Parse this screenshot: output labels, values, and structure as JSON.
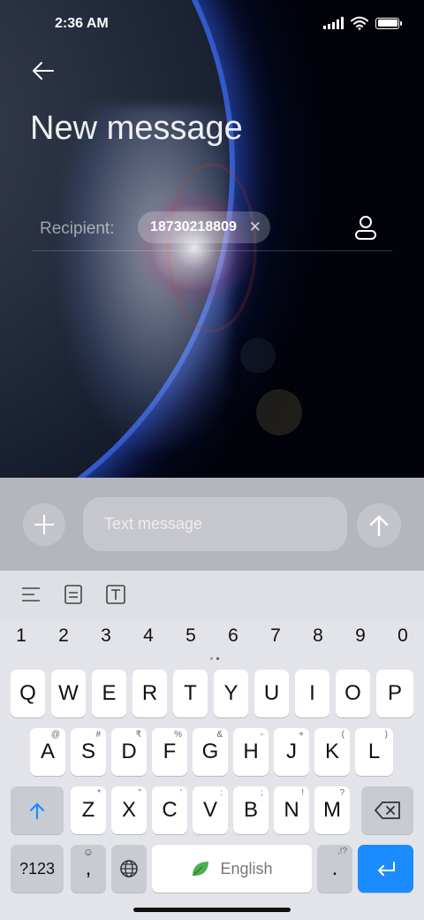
{
  "status_bar": {
    "time": "2:36 AM",
    "icons": [
      "signal-icon",
      "wifi-icon",
      "battery-icon"
    ]
  },
  "header": {
    "back_icon": "back-arrow-icon",
    "title": "New message"
  },
  "recipient": {
    "label": "Recipient:",
    "chip_value": "18730218809",
    "chip_remove_icon": "close-icon",
    "contact_icon": "contact-icon"
  },
  "composer": {
    "add_icon": "plus-icon",
    "placeholder": "Text message",
    "send_icon": "send-arrow-icon"
  },
  "keyboard": {
    "toolbar_icons": [
      "menu-lines-icon",
      "clipboard-icon",
      "text-format-icon"
    ],
    "number_row": [
      "1",
      "2",
      "3",
      "4",
      "5",
      "6",
      "7",
      "8",
      "9",
      "0"
    ],
    "row1": [
      "Q",
      "W",
      "E",
      "R",
      "T",
      "Y",
      "U",
      "I",
      "O",
      "P"
    ],
    "row2": [
      {
        "key": "A",
        "hint": "@"
      },
      {
        "key": "S",
        "hint": "#"
      },
      {
        "key": "D",
        "hint": "₹"
      },
      {
        "key": "F",
        "hint": "%"
      },
      {
        "key": "G",
        "hint": "&"
      },
      {
        "key": "H",
        "hint": "-"
      },
      {
        "key": "J",
        "hint": "+"
      },
      {
        "key": "K",
        "hint": "("
      },
      {
        "key": "L",
        "hint": ")"
      }
    ],
    "row3": [
      {
        "key": "Z",
        "hint": "*"
      },
      {
        "key": "X",
        "hint": "\""
      },
      {
        "key": "C",
        "hint": "'"
      },
      {
        "key": "V",
        "hint": ":"
      },
      {
        "key": "B",
        "hint": ";"
      },
      {
        "key": "N",
        "hint": "!"
      },
      {
        "key": "M",
        "hint": "?"
      }
    ],
    "bottom_row": {
      "symbols_label": "?123",
      "comma_label": ",",
      "comma_hint": "☺",
      "globe_icon": "globe-icon",
      "space_label": "English",
      "space_icon": "leaf-icon",
      "period_label": ".",
      "period_hint": ",!?",
      "enter_icon": "enter-icon"
    },
    "shift_icon": "shift-arrow-icon",
    "backspace_icon": "backspace-icon",
    "accent_color": "#1a8cff"
  }
}
